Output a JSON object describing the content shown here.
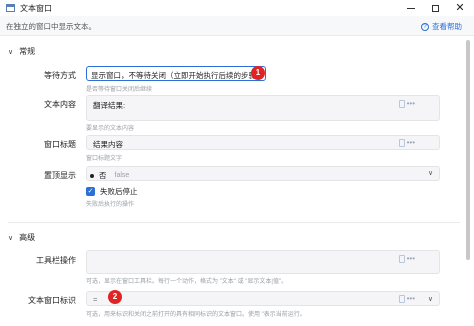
{
  "window": {
    "title": "文本窗口",
    "min_label": "—",
    "max_label": "",
    "close_label": "✕"
  },
  "header": {
    "description": "在独立的窗口中显示文本。",
    "doc_link": "查看帮助"
  },
  "sections": {
    "general": "常规",
    "advanced": "高级"
  },
  "fields": {
    "wait_mode": {
      "label": "等待方式",
      "value": "显示窗口，不等待关闭（立即开始执行后续的步骤）",
      "hint": "是否等待窗口关闭后继续",
      "badge": "1"
    },
    "text_content": {
      "label": "文本内容",
      "value": "翻译结果:",
      "hint": "要显示的文本内容"
    },
    "window_title": {
      "label": "窗口标题",
      "value": "结果内容",
      "hint": "窗口标题文字"
    },
    "topmost": {
      "label": "置顶显示",
      "value": "否",
      "value_raw": "false"
    },
    "stop_on_fail": {
      "label": "失败后停止",
      "hint": "失败后执行的操作",
      "checked": true
    },
    "toolbar_ops": {
      "label": "工具栏操作",
      "hint": "可选，显示在窗口工具栏。每行一个动作，格式为 \"文本\" 或 \"显示文本|值\"。"
    },
    "window_id": {
      "label": "文本窗口标识",
      "value": "=",
      "hint": "可选，用来标识和关闭之前打开的具有相同标识的文本窗口。使用 \"表示当前运行。",
      "badge": "2"
    }
  },
  "colors": {
    "accent": "#2c6fd6",
    "badge": "#e02424"
  }
}
